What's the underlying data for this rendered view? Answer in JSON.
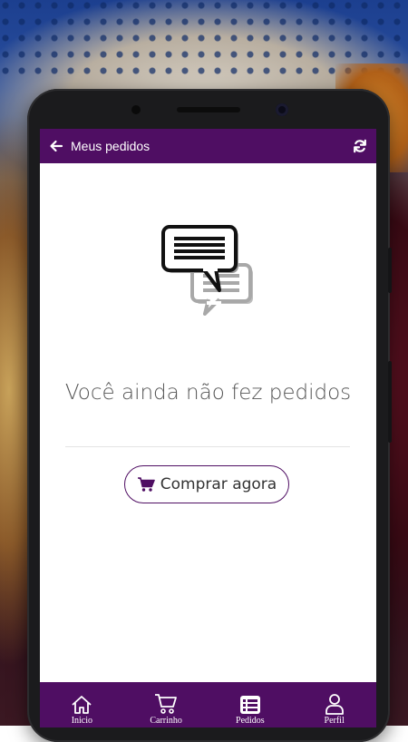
{
  "appbar": {
    "title": "Meus pedidos",
    "back_icon": "arrow-left-icon",
    "refresh_icon": "refresh-icon"
  },
  "empty_state": {
    "icon": "chat-bubbles-icon",
    "message": "Você ainda não fez pedidos",
    "button_label": "Comprar agora",
    "button_icon": "shopping-cart-icon"
  },
  "bottom_nav": {
    "items": [
      {
        "label": "Inicio",
        "icon": "home-icon"
      },
      {
        "label": "Carrinho",
        "icon": "cart-icon"
      },
      {
        "label": "Pedidos",
        "icon": "list-icon"
      },
      {
        "label": "Perfil",
        "icon": "user-icon"
      }
    ]
  },
  "colors": {
    "primary": "#4f0e63",
    "text": "#555555",
    "background": "#ffffff"
  }
}
